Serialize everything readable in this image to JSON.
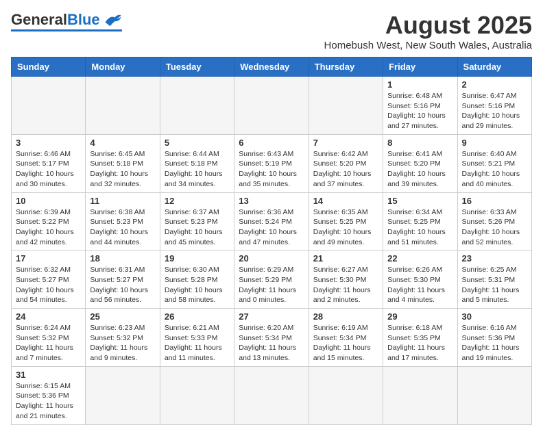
{
  "header": {
    "logo_general": "General",
    "logo_blue": "Blue",
    "month_title": "August 2025",
    "location": "Homebush West, New South Wales, Australia"
  },
  "weekdays": [
    "Sunday",
    "Monday",
    "Tuesday",
    "Wednesday",
    "Thursday",
    "Friday",
    "Saturday"
  ],
  "weeks": [
    [
      {
        "day": "",
        "info": ""
      },
      {
        "day": "",
        "info": ""
      },
      {
        "day": "",
        "info": ""
      },
      {
        "day": "",
        "info": ""
      },
      {
        "day": "",
        "info": ""
      },
      {
        "day": "1",
        "info": "Sunrise: 6:48 AM\nSunset: 5:16 PM\nDaylight: 10 hours and 27 minutes."
      },
      {
        "day": "2",
        "info": "Sunrise: 6:47 AM\nSunset: 5:16 PM\nDaylight: 10 hours and 29 minutes."
      }
    ],
    [
      {
        "day": "3",
        "info": "Sunrise: 6:46 AM\nSunset: 5:17 PM\nDaylight: 10 hours and 30 minutes."
      },
      {
        "day": "4",
        "info": "Sunrise: 6:45 AM\nSunset: 5:18 PM\nDaylight: 10 hours and 32 minutes."
      },
      {
        "day": "5",
        "info": "Sunrise: 6:44 AM\nSunset: 5:18 PM\nDaylight: 10 hours and 34 minutes."
      },
      {
        "day": "6",
        "info": "Sunrise: 6:43 AM\nSunset: 5:19 PM\nDaylight: 10 hours and 35 minutes."
      },
      {
        "day": "7",
        "info": "Sunrise: 6:42 AM\nSunset: 5:20 PM\nDaylight: 10 hours and 37 minutes."
      },
      {
        "day": "8",
        "info": "Sunrise: 6:41 AM\nSunset: 5:20 PM\nDaylight: 10 hours and 39 minutes."
      },
      {
        "day": "9",
        "info": "Sunrise: 6:40 AM\nSunset: 5:21 PM\nDaylight: 10 hours and 40 minutes."
      }
    ],
    [
      {
        "day": "10",
        "info": "Sunrise: 6:39 AM\nSunset: 5:22 PM\nDaylight: 10 hours and 42 minutes."
      },
      {
        "day": "11",
        "info": "Sunrise: 6:38 AM\nSunset: 5:23 PM\nDaylight: 10 hours and 44 minutes."
      },
      {
        "day": "12",
        "info": "Sunrise: 6:37 AM\nSunset: 5:23 PM\nDaylight: 10 hours and 45 minutes."
      },
      {
        "day": "13",
        "info": "Sunrise: 6:36 AM\nSunset: 5:24 PM\nDaylight: 10 hours and 47 minutes."
      },
      {
        "day": "14",
        "info": "Sunrise: 6:35 AM\nSunset: 5:25 PM\nDaylight: 10 hours and 49 minutes."
      },
      {
        "day": "15",
        "info": "Sunrise: 6:34 AM\nSunset: 5:25 PM\nDaylight: 10 hours and 51 minutes."
      },
      {
        "day": "16",
        "info": "Sunrise: 6:33 AM\nSunset: 5:26 PM\nDaylight: 10 hours and 52 minutes."
      }
    ],
    [
      {
        "day": "17",
        "info": "Sunrise: 6:32 AM\nSunset: 5:27 PM\nDaylight: 10 hours and 54 minutes."
      },
      {
        "day": "18",
        "info": "Sunrise: 6:31 AM\nSunset: 5:27 PM\nDaylight: 10 hours and 56 minutes."
      },
      {
        "day": "19",
        "info": "Sunrise: 6:30 AM\nSunset: 5:28 PM\nDaylight: 10 hours and 58 minutes."
      },
      {
        "day": "20",
        "info": "Sunrise: 6:29 AM\nSunset: 5:29 PM\nDaylight: 11 hours and 0 minutes."
      },
      {
        "day": "21",
        "info": "Sunrise: 6:27 AM\nSunset: 5:30 PM\nDaylight: 11 hours and 2 minutes."
      },
      {
        "day": "22",
        "info": "Sunrise: 6:26 AM\nSunset: 5:30 PM\nDaylight: 11 hours and 4 minutes."
      },
      {
        "day": "23",
        "info": "Sunrise: 6:25 AM\nSunset: 5:31 PM\nDaylight: 11 hours and 5 minutes."
      }
    ],
    [
      {
        "day": "24",
        "info": "Sunrise: 6:24 AM\nSunset: 5:32 PM\nDaylight: 11 hours and 7 minutes."
      },
      {
        "day": "25",
        "info": "Sunrise: 6:23 AM\nSunset: 5:32 PM\nDaylight: 11 hours and 9 minutes."
      },
      {
        "day": "26",
        "info": "Sunrise: 6:21 AM\nSunset: 5:33 PM\nDaylight: 11 hours and 11 minutes."
      },
      {
        "day": "27",
        "info": "Sunrise: 6:20 AM\nSunset: 5:34 PM\nDaylight: 11 hours and 13 minutes."
      },
      {
        "day": "28",
        "info": "Sunrise: 6:19 AM\nSunset: 5:34 PM\nDaylight: 11 hours and 15 minutes."
      },
      {
        "day": "29",
        "info": "Sunrise: 6:18 AM\nSunset: 5:35 PM\nDaylight: 11 hours and 17 minutes."
      },
      {
        "day": "30",
        "info": "Sunrise: 6:16 AM\nSunset: 5:36 PM\nDaylight: 11 hours and 19 minutes."
      }
    ],
    [
      {
        "day": "31",
        "info": "Sunrise: 6:15 AM\nSunset: 5:36 PM\nDaylight: 11 hours and 21 minutes."
      },
      {
        "day": "",
        "info": ""
      },
      {
        "day": "",
        "info": ""
      },
      {
        "day": "",
        "info": ""
      },
      {
        "day": "",
        "info": ""
      },
      {
        "day": "",
        "info": ""
      },
      {
        "day": "",
        "info": ""
      }
    ]
  ]
}
